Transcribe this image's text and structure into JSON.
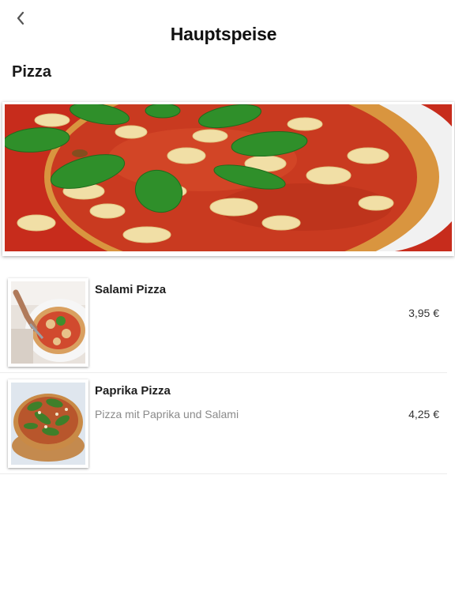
{
  "header": {
    "back_icon": "chevron-left-icon",
    "title": "Hauptspeise"
  },
  "category": {
    "title": "Pizza"
  },
  "items": [
    {
      "name": "Salami Pizza",
      "description": "",
      "price": "3,95 €"
    },
    {
      "name": "Paprika Pizza",
      "description": "Pizza mit Paprika und Salami",
      "price": "4,25 €"
    }
  ],
  "colors": {
    "sauce": "#c8301e",
    "crust": "#d89a4a",
    "basil": "#2f8f2a",
    "divider": "#ececec"
  }
}
